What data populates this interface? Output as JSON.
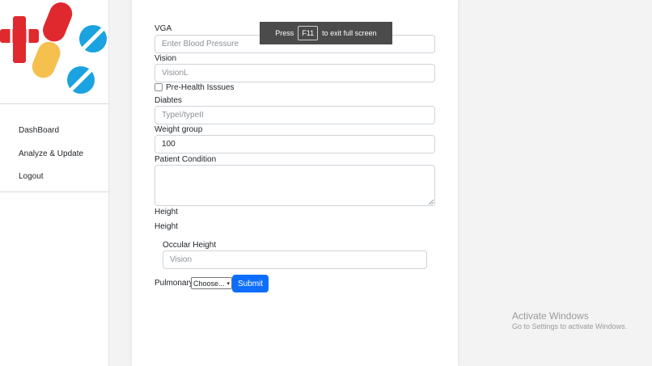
{
  "sidebar": {
    "logo_icon": "medical-pills-cross-logo",
    "items": [
      {
        "label": "DashBoard"
      },
      {
        "label": "Analyze & Update"
      },
      {
        "label": "Logout"
      }
    ]
  },
  "form": {
    "vga": {
      "label": "VGA",
      "placeholder": "Enter Blood Pressure",
      "value": ""
    },
    "vision": {
      "label": "Vision",
      "placeholder": "VisionL",
      "value": ""
    },
    "pre_health": {
      "label": "Pre-Health Isssues",
      "checked": false
    },
    "diabetes": {
      "label": "Diabtes",
      "placeholder": "TypeI/typeII",
      "value": ""
    },
    "weight": {
      "label": "Weight group",
      "value": "100"
    },
    "patient_condition": {
      "label": "Patient Condition",
      "value": ""
    },
    "height_1": {
      "label": "Height"
    },
    "height_2": {
      "label": "Height"
    },
    "occular": {
      "label": "Occular Height",
      "placeholder": "Vision",
      "value": ""
    },
    "pulmonary": {
      "label": "Pulmonary",
      "selected": "Choose..."
    },
    "submit_label": "Submit"
  },
  "fullscreen_toast": {
    "prefix": "Press",
    "key": "F11",
    "suffix": "to exit full screen"
  },
  "watermark": {
    "title": "Activate Windows",
    "subtitle": "Go to Settings to activate Windows."
  },
  "colors": {
    "primary": "#0d6efd",
    "cross_red": "#e0292e",
    "pill_blue": "#1aa3e0",
    "pill_yellow": "#f5c04e"
  }
}
